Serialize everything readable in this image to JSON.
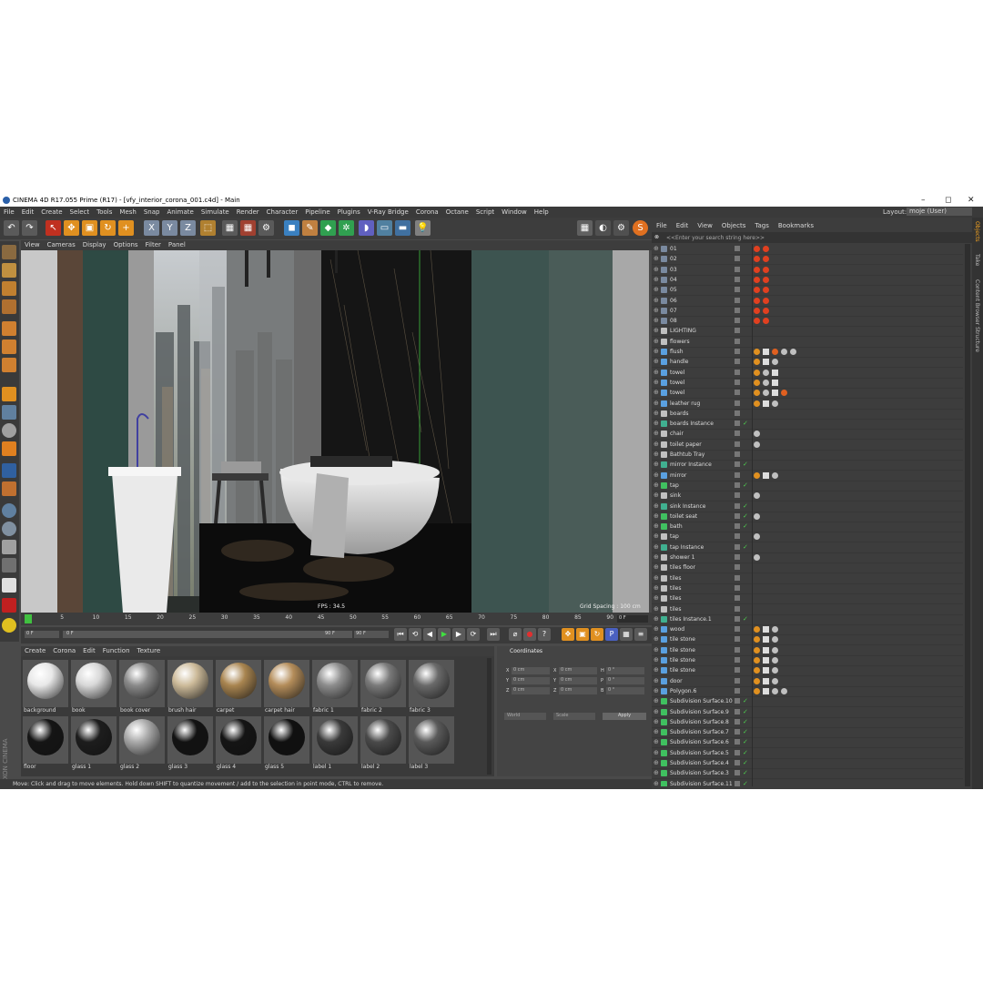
{
  "window": {
    "title": "CINEMA 4D R17.055 Prime (R17) - [vfy_interior_corona_001.c4d] - Main",
    "minimize": "–",
    "maximize": "◻",
    "close": "✕"
  },
  "menubar": [
    "File",
    "Edit",
    "Create",
    "Select",
    "Tools",
    "Mesh",
    "Snap",
    "Animate",
    "Simulate",
    "Render",
    "Character",
    "Pipeline",
    "Plugins",
    "V-Ray Bridge",
    "Corona",
    "Octane",
    "Script",
    "Window",
    "Help"
  ],
  "layout": {
    "label": "Layout:",
    "value": "moje (User)"
  },
  "viewport": {
    "menu": [
      "View",
      "Cameras",
      "Display",
      "Options",
      "Filter",
      "Panel"
    ],
    "camera_label": "Perspective",
    "fps": "FPS : 34.5",
    "grid_spacing": "Grid Spacing : 100 cm"
  },
  "timeline": {
    "ticks": [
      "0",
      "5",
      "10",
      "15",
      "20",
      "25",
      "30",
      "35",
      "40",
      "45",
      "50",
      "55",
      "60",
      "65",
      "70",
      "75",
      "80",
      "85",
      "90"
    ],
    "frame_field": "0 F",
    "start_field": "0 F",
    "min_field": "0 F",
    "end_field": "90 F",
    "max_field": "90 F"
  },
  "materials": {
    "menu": [
      "Create",
      "Corona",
      "Edit",
      "Function",
      "Texture"
    ],
    "items": [
      {
        "label": "background",
        "color": "#e8e8e8"
      },
      {
        "label": "book",
        "color": "#d8d8d8"
      },
      {
        "label": "book cover",
        "color": "#8a8a8a"
      },
      {
        "label": "brush hair",
        "color": "#cdbb9a"
      },
      {
        "label": "carpet",
        "color": "#a98550"
      },
      {
        "label": "carpet hair",
        "color": "#b48d5a"
      },
      {
        "label": "fabric 1",
        "color": "#8d8d8d"
      },
      {
        "label": "fabric 2",
        "color": "#7a7a7a"
      },
      {
        "label": "fabric 3",
        "color": "#6a6a6a"
      },
      {
        "label": "floor",
        "color": "#151515"
      },
      {
        "label": "glass 1",
        "color": "#1d1d1d"
      },
      {
        "label": "glass 2",
        "color": "#aaaaaa"
      },
      {
        "label": "glass 3",
        "color": "#121212"
      },
      {
        "label": "glass 4",
        "color": "#141414"
      },
      {
        "label": "glass 5",
        "color": "#101010"
      },
      {
        "label": "label 1",
        "color": "#3a3a3a"
      },
      {
        "label": "label 2",
        "color": "#4a4a4a"
      },
      {
        "label": "label 3",
        "color": "#5a5a5a"
      }
    ]
  },
  "coordinates": {
    "title": "Coordinates",
    "col_headers": [
      "X",
      "Y",
      "Z"
    ],
    "fields": [
      "0 cm",
      "0 cm",
      "0 cm",
      "0 cm",
      "0 cm",
      "0 cm",
      "0 °",
      "0 °",
      "0 °"
    ],
    "pos_labels": [
      "X",
      "Y",
      "Z"
    ],
    "size_labels": [
      "X",
      "Y",
      "Z"
    ],
    "rot_labels": [
      "H",
      "P",
      "B"
    ],
    "mode_world": "World",
    "mode_scale": "Scale",
    "apply": "Apply"
  },
  "status": "Move: Click and drag to move elements. Hold down SHIFT to quantize movement / add to the selection in point mode, CTRL to remove.",
  "object_manager": {
    "menu": [
      "File",
      "Edit",
      "View",
      "Objects",
      "Tags",
      "Bookmarks"
    ],
    "search_placeholder": "<<Enter your search string here>>",
    "side_tabs": [
      "Objects",
      "Take",
      "Content Browser",
      "Structure"
    ],
    "objects": [
      {
        "name": "01",
        "type": "camera",
        "tags": [
          "cam",
          "cam"
        ]
      },
      {
        "name": "02",
        "type": "camera",
        "tags": [
          "cam",
          "cam"
        ]
      },
      {
        "name": "03",
        "type": "camera",
        "tags": [
          "cam",
          "cam"
        ]
      },
      {
        "name": "04",
        "type": "camera",
        "tags": [
          "cam",
          "cam"
        ]
      },
      {
        "name": "05",
        "type": "camera",
        "tags": [
          "cam",
          "cam"
        ]
      },
      {
        "name": "06",
        "type": "camera",
        "tags": [
          "cam",
          "cam"
        ]
      },
      {
        "name": "07",
        "type": "camera",
        "tags": [
          "cam",
          "cam"
        ]
      },
      {
        "name": "08",
        "type": "camera",
        "tags": [
          "cam",
          "cam"
        ]
      },
      {
        "name": "LIGHTING",
        "type": "null",
        "tags": []
      },
      {
        "name": "flowers",
        "type": "null",
        "tags": []
      },
      {
        "name": "flush",
        "type": "poly",
        "tags": [
          "uv",
          "chk",
          "warn",
          "mat",
          "mat"
        ]
      },
      {
        "name": "handle",
        "type": "poly",
        "tags": [
          "uv",
          "chk",
          "mat"
        ]
      },
      {
        "name": "towel",
        "type": "poly",
        "tags": [
          "uv",
          "mat",
          "chk"
        ]
      },
      {
        "name": "towel",
        "type": "poly",
        "tags": [
          "uv",
          "mat",
          "chk"
        ]
      },
      {
        "name": "towel",
        "type": "poly",
        "tags": [
          "uv",
          "mat",
          "chk",
          "warn"
        ]
      },
      {
        "name": "leather rug",
        "type": "poly",
        "tags": [
          "uv",
          "chk",
          "mat"
        ]
      },
      {
        "name": "boards",
        "type": "null",
        "tags": []
      },
      {
        "name": "boards Instance",
        "type": "inst",
        "tags": []
      },
      {
        "name": "chair",
        "type": "null",
        "tags": [
          "mat"
        ]
      },
      {
        "name": "toilet paper",
        "type": "null",
        "tags": [
          "mat"
        ]
      },
      {
        "name": "Bathtub Tray",
        "type": "null",
        "tags": []
      },
      {
        "name": "mirror Instance",
        "type": "inst",
        "tags": []
      },
      {
        "name": "mirror",
        "type": "poly",
        "tags": [
          "uv",
          "chk",
          "mat"
        ]
      },
      {
        "name": "tap",
        "type": "sub",
        "tags": []
      },
      {
        "name": "sink",
        "type": "null",
        "tags": [
          "mat"
        ]
      },
      {
        "name": "sink Instance",
        "type": "inst",
        "tags": []
      },
      {
        "name": "toilet seat",
        "type": "sub",
        "tags": [
          "mat"
        ]
      },
      {
        "name": "bath",
        "type": "sub",
        "tags": []
      },
      {
        "name": "tap",
        "type": "null",
        "tags": [
          "mat"
        ]
      },
      {
        "name": "tap Instance",
        "type": "inst",
        "tags": []
      },
      {
        "name": "shower 1",
        "type": "null",
        "tags": [
          "mat"
        ]
      },
      {
        "name": "tiles floor",
        "type": "null",
        "tags": []
      },
      {
        "name": "tiles",
        "type": "null",
        "tags": []
      },
      {
        "name": "tiles",
        "type": "null",
        "tags": []
      },
      {
        "name": "tiles",
        "type": "null",
        "tags": []
      },
      {
        "name": "tiles",
        "type": "null",
        "tags": []
      },
      {
        "name": "tiles Instance.1",
        "type": "inst",
        "tags": []
      },
      {
        "name": "wood",
        "type": "poly",
        "tags": [
          "uv",
          "chk",
          "mat"
        ]
      },
      {
        "name": "tile stone",
        "type": "poly",
        "tags": [
          "uv",
          "chk",
          "mat"
        ]
      },
      {
        "name": "tile stone",
        "type": "poly",
        "tags": [
          "uv",
          "chk",
          "mat"
        ]
      },
      {
        "name": "tile stone",
        "type": "poly",
        "tags": [
          "uv",
          "chk",
          "mat"
        ]
      },
      {
        "name": "tile stone",
        "type": "poly",
        "tags": [
          "uv",
          "chk",
          "mat"
        ]
      },
      {
        "name": "door",
        "type": "poly",
        "tags": [
          "uv",
          "chk",
          "mat"
        ]
      },
      {
        "name": "Polygon.6",
        "type": "poly",
        "tags": [
          "uv",
          "chk",
          "mat",
          "mat"
        ]
      },
      {
        "name": "Subdivision Surface.10",
        "type": "sub",
        "tags": []
      },
      {
        "name": "Subdivision Surface.9",
        "type": "sub",
        "tags": []
      },
      {
        "name": "Subdivision Surface.8",
        "type": "sub",
        "tags": []
      },
      {
        "name": "Subdivision Surface.7",
        "type": "sub",
        "tags": []
      },
      {
        "name": "Subdivision Surface.6",
        "type": "sub",
        "tags": []
      },
      {
        "name": "Subdivision Surface.5",
        "type": "sub",
        "tags": []
      },
      {
        "name": "Subdivision Surface.4",
        "type": "sub",
        "tags": []
      },
      {
        "name": "Subdivision Surface.3",
        "type": "sub",
        "tags": []
      },
      {
        "name": "Subdivision Surface.11",
        "type": "sub",
        "tags": []
      }
    ]
  },
  "brand": "MAXON CINEMA 4D",
  "colors": {
    "accent": "#f0a020",
    "green_check": "#4ecb4e",
    "icon_blue": "#5aa0e0",
    "icon_green": "#40c060",
    "warn": "#e04020"
  }
}
